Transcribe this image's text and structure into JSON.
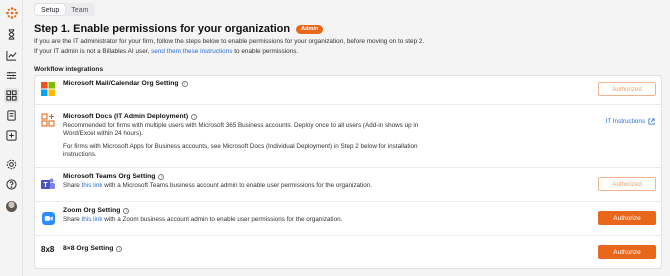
{
  "tabs": [
    {
      "label": "Setup"
    },
    {
      "label": "Team"
    }
  ],
  "header": {
    "title": "Step 1. Enable permissions for your organization",
    "badge": "Admin",
    "line1": "If you are the IT administrator for your firm, follow the steps below to enable permissions for your organization, before moving on to step 2.",
    "line2_prefix": "If your IT admin is not a Billables AI user, ",
    "line2_link": "send them these instructions",
    "line2_suffix": " to enable permissions."
  },
  "section_title": "Workflow integrations",
  "integrations": {
    "ms_mail": {
      "name": "Microsoft Mail/Calendar Org Setting",
      "button": "Authorized",
      "icon": "microsoft-logo-icon"
    },
    "ms_docs": {
      "name": "Microsoft Docs (IT Admin Deployment)",
      "desc1": "Recommended for firms with multiple users with Microsoft 365 Business accounts. Deploy once to all users (Add-in shows up in",
      "desc2": "Word/Excel within 24 hours).",
      "desc3": "For firms with Microsoft Apps for Business accounts, see Microsoft Docs (Individual Deployment) in Step 2 below for installation",
      "desc4": "instructions.",
      "link": "IT Instructions",
      "icon": "apps-grid-icon"
    },
    "ms_teams": {
      "name": "Microsoft Teams Org Setting",
      "desc_prefix": "Share ",
      "desc_link": "this link",
      "desc_suffix": " with a Microsoft Teams business account admin to enable user permissions for the organization.",
      "button": "Authorized",
      "icon": "teams-icon"
    },
    "zoom": {
      "name": "Zoom Org Setting",
      "desc_prefix": "Share ",
      "desc_link": "this link",
      "desc_suffix": " with a Zoom business account admin to enable user permissions for the organization.",
      "button": "Authorize",
      "icon": "zoom-icon"
    },
    "eight": {
      "name": "8×8 Org Setting",
      "logo": "8x8",
      "button": "Authorize"
    }
  },
  "colors": {
    "accent": "#e8671b",
    "link": "#2b6fd6"
  },
  "rail_icons": [
    "logo-icon",
    "hourglass-icon",
    "chart-icon",
    "sliders-icon",
    "integrations-icon",
    "notes-icon",
    "add-icon",
    "settings-icon",
    "help-icon",
    "avatar"
  ]
}
